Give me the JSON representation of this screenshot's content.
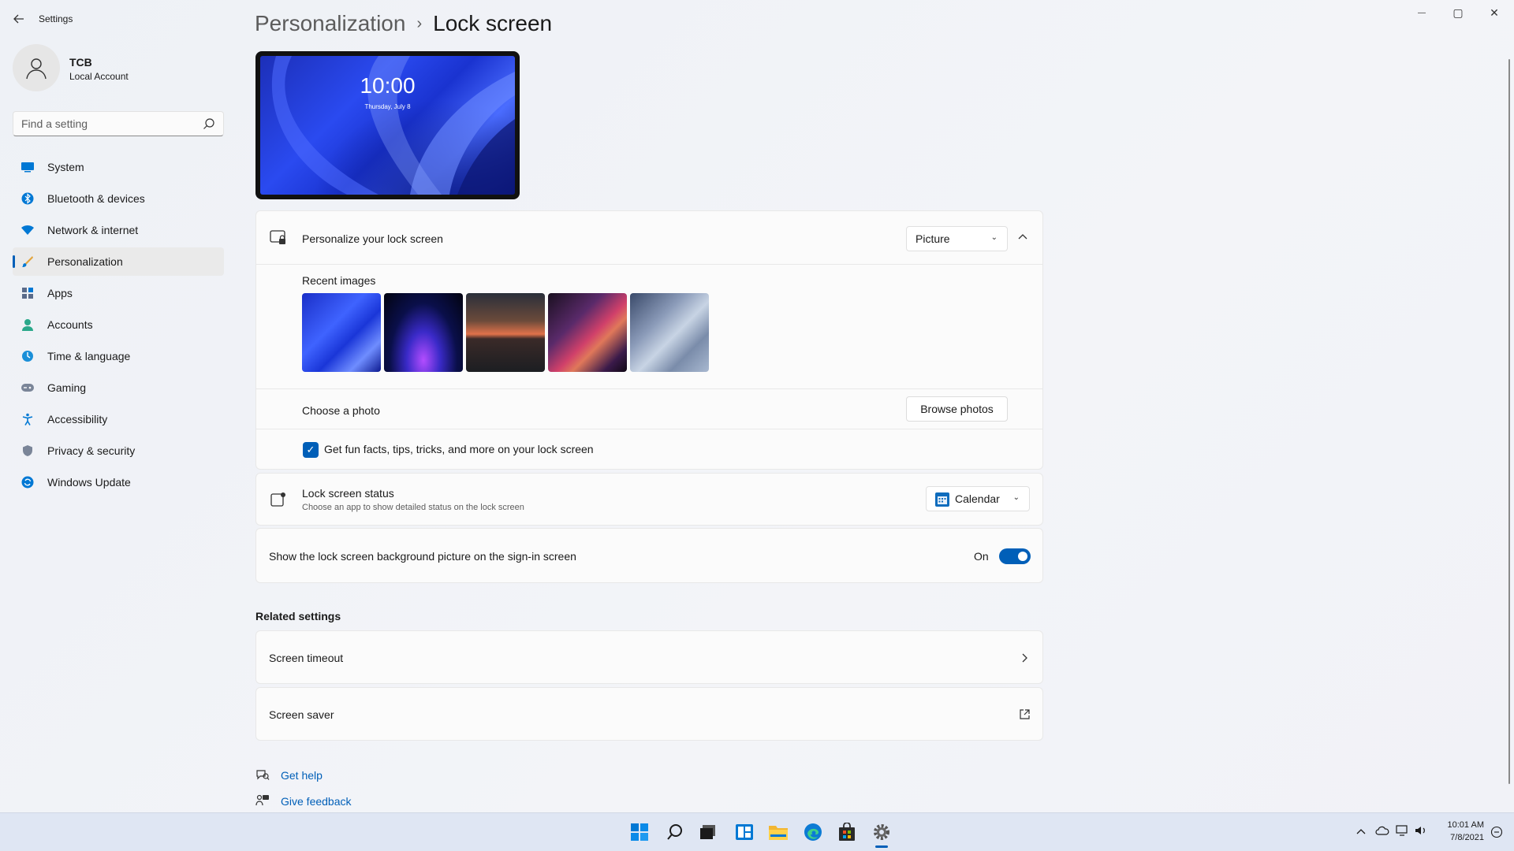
{
  "app": {
    "title": "Settings",
    "window_controls": {
      "minimize": "—",
      "maximize": "▢",
      "close": "✕"
    }
  },
  "profile": {
    "name": "TCB",
    "account_type": "Local Account"
  },
  "search": {
    "placeholder": "Find a setting"
  },
  "sidebar": {
    "items": [
      {
        "label": "System",
        "icon": "system-icon",
        "active": false
      },
      {
        "label": "Bluetooth & devices",
        "icon": "bluetooth-icon",
        "active": false
      },
      {
        "label": "Network & internet",
        "icon": "wifi-icon",
        "active": false
      },
      {
        "label": "Personalization",
        "icon": "brush-icon",
        "active": true
      },
      {
        "label": "Apps",
        "icon": "apps-icon",
        "active": false
      },
      {
        "label": "Accounts",
        "icon": "accounts-icon",
        "active": false
      },
      {
        "label": "Time & language",
        "icon": "globe-clock-icon",
        "active": false
      },
      {
        "label": "Gaming",
        "icon": "gamepad-icon",
        "active": false
      },
      {
        "label": "Accessibility",
        "icon": "accessibility-icon",
        "active": false
      },
      {
        "label": "Privacy & security",
        "icon": "shield-icon",
        "active": false
      },
      {
        "label": "Windows Update",
        "icon": "update-icon",
        "active": false
      }
    ]
  },
  "breadcrumb": {
    "parent": "Personalization",
    "separator": "›",
    "current": "Lock screen"
  },
  "preview": {
    "time": "10:00",
    "date": "Thursday, July 8"
  },
  "personalize": {
    "title": "Personalize your lock screen",
    "selected": "Picture",
    "recent_label": "Recent images",
    "images": [
      "blue-bloom",
      "dark-bloom",
      "sunset-lake",
      "purple-ribbon",
      "grey-bloom"
    ],
    "choose_label": "Choose a photo",
    "browse_label": "Browse photos",
    "fun_facts_label": "Get fun facts, tips, tricks, and more on your lock screen",
    "fun_facts_checked": true
  },
  "status": {
    "title": "Lock screen status",
    "subtitle": "Choose an app to show detailed status on the lock screen",
    "selected": "Calendar"
  },
  "signin": {
    "label": "Show the lock screen background picture on the sign-in screen",
    "state": "On",
    "enabled": true
  },
  "related": {
    "title": "Related settings",
    "items": [
      {
        "label": "Screen timeout",
        "icon": "chevron-right-icon"
      },
      {
        "label": "Screen saver",
        "icon": "external-link-icon"
      }
    ]
  },
  "help": {
    "get_help": "Get help",
    "feedback": "Give feedback"
  },
  "taskbar": {
    "apps": [
      "start-icon",
      "search-icon",
      "task-view-icon",
      "widgets-icon",
      "file-explorer-icon",
      "edge-icon",
      "store-icon",
      "settings-icon"
    ],
    "time": "10:01 AM",
    "date": "7/8/2021"
  },
  "colors": {
    "accent": "#005fb8"
  }
}
